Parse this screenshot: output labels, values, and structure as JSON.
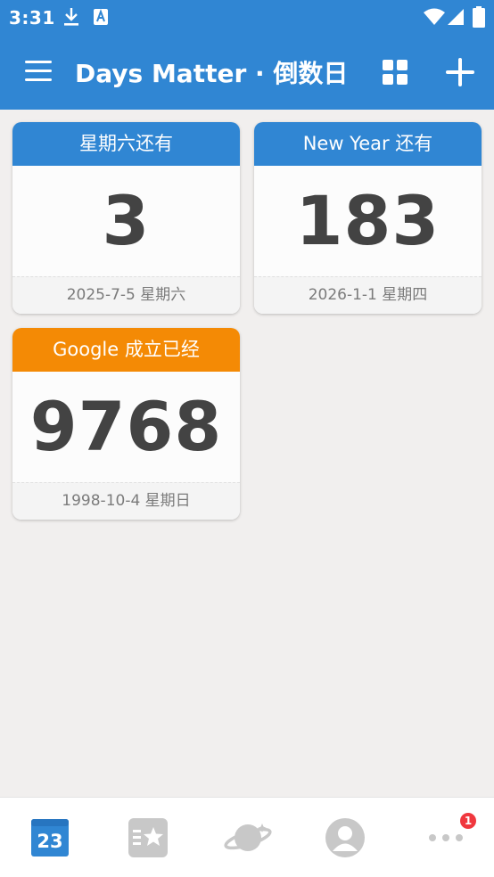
{
  "status_bar": {
    "time": "3:31"
  },
  "app_bar": {
    "title": "Days Matter · 倒数日"
  },
  "cards": [
    {
      "title": "星期六还有",
      "days": "3",
      "date": "2025-7-5 星期六",
      "color": "#3086d3"
    },
    {
      "title": "New Year 还有",
      "days": "183",
      "date": "2026-1-1 星期四",
      "color": "#3086d3"
    },
    {
      "title": "Google 成立已经",
      "days": "9768",
      "date": "1998-10-4 星期日",
      "color": "#f48a05"
    }
  ],
  "bottom_nav": {
    "calendar_day": "23",
    "badge_count": "1",
    "items": [
      "calendar-icon",
      "starred-list-icon",
      "planet-icon",
      "profile-icon",
      "more-icon"
    ]
  },
  "colors": {
    "primary": "#3086d3",
    "accent": "#f48a05",
    "badge": "#f0373e",
    "background": "#f1efee"
  }
}
